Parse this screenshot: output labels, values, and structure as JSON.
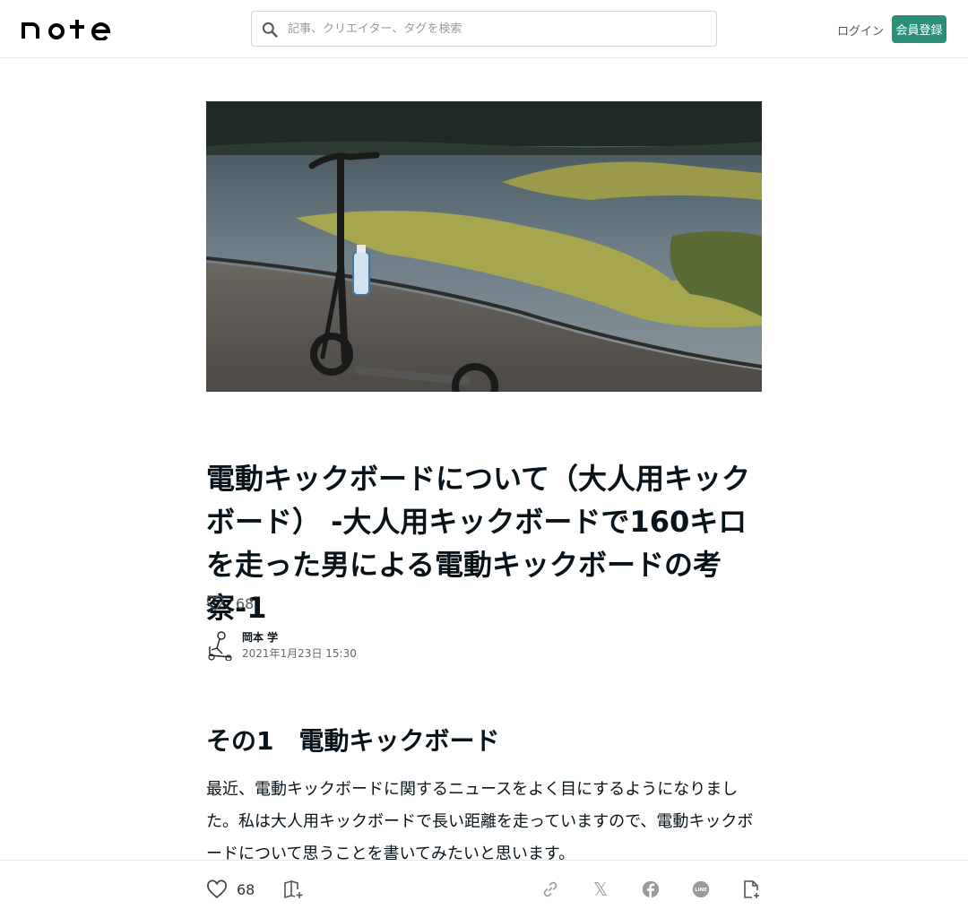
{
  "header": {
    "logo_text": "note",
    "search_placeholder": "記事、クリエイター、タグを検索",
    "login_label": "ログイン",
    "signup_label": "会員登録"
  },
  "article": {
    "title": "電動キックボードについて（大人用キックボード） -大人用キックボードで160キロを走った男による電動キックボードの考察-1",
    "like_count": "68",
    "author_name": "岡本 学",
    "post_date": "2021年1月23日 15:30",
    "section_heading": "その1　電動キックボード",
    "body": "最近、電動キックボードに関するニュースをよく目にするようになりました。私は大人用キックボードで長い距離を走っていますので、電動キックボードについて思うことを書いてみたいと思います。"
  },
  "bottom_bar": {
    "like_count": "68"
  },
  "icons": {
    "search": "search-icon",
    "like": "heart-outline-icon",
    "magazine": "add-to-magazine-icon",
    "link": "link-icon",
    "x": "x-share-icon",
    "facebook": "facebook-icon",
    "line": "line-icon",
    "save": "add-note-icon"
  },
  "colors": {
    "accent": "#2b8f79",
    "text": "#08131a",
    "icon": "#999999"
  }
}
